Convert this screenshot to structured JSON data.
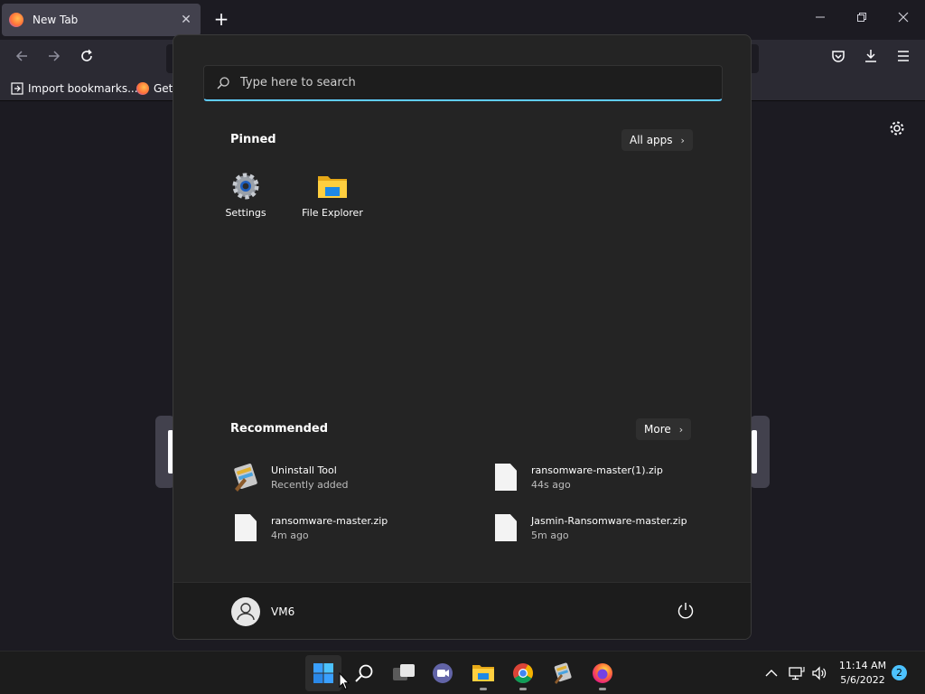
{
  "browser": {
    "tab_title": "New Tab",
    "tab_close": "✕",
    "new_tab": "+",
    "bookmarks": [
      {
        "label": "Import bookmarks..."
      },
      {
        "label": "Gett"
      }
    ]
  },
  "start_menu": {
    "search_placeholder": "Type here to search",
    "pinned_title": "Pinned",
    "all_apps_label": "All apps",
    "pinned": [
      {
        "label": "Settings",
        "icon": "settings-gear-icon"
      },
      {
        "label": "File Explorer",
        "icon": "folder-icon"
      }
    ],
    "recommended_title": "Recommended",
    "more_label": "More",
    "recommended": [
      {
        "name": "Uninstall Tool",
        "sub": "Recently added",
        "icon": "uninstall-tool-icon"
      },
      {
        "name": "ransomware-master(1).zip",
        "sub": "44s ago",
        "icon": "file-icon"
      },
      {
        "name": "ransomware-master.zip",
        "sub": "4m ago",
        "icon": "file-icon"
      },
      {
        "name": "Jasmin-Ransomware-master.zip",
        "sub": "5m ago",
        "icon": "file-icon"
      }
    ],
    "user_name": "VM6"
  },
  "taskbar": {
    "time": "11:14 AM",
    "date": "5/6/2022",
    "notification_count": "2"
  },
  "colors": {
    "accent": "#60cdff",
    "menu_bg": "#242424",
    "browser_bg": "#1c1b22"
  }
}
